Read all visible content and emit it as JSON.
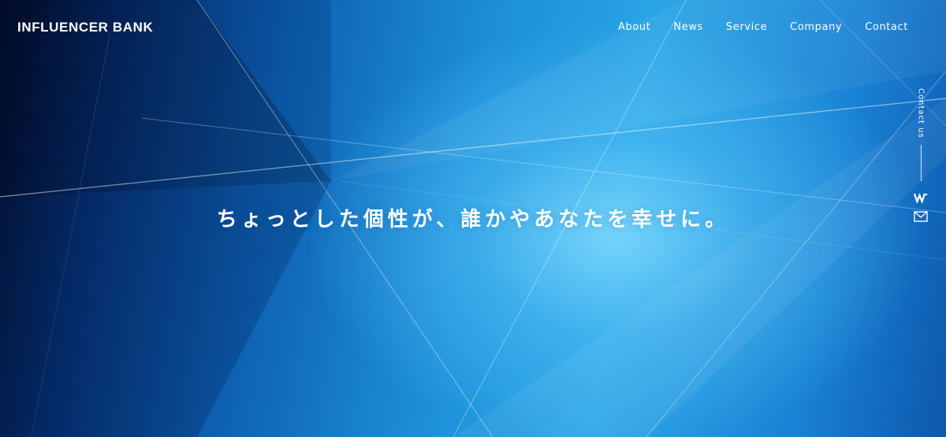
{
  "brand": {
    "logo_text": "INFLUENCER BANK"
  },
  "nav": {
    "items": [
      {
        "label": "About"
      },
      {
        "label": "News"
      },
      {
        "label": "Service"
      },
      {
        "label": "Company"
      },
      {
        "label": "Contact"
      }
    ]
  },
  "side": {
    "contact_label": "Contact us",
    "icons": [
      "w-logo-icon",
      "mail-icon"
    ]
  },
  "hero": {
    "tagline": "ちょっとした個性が、誰かやあなたを幸せに。",
    "colors": {
      "dark_edge": "#020c24",
      "mid_blue": "#1c8ed8",
      "glow": "#82dcff"
    }
  }
}
